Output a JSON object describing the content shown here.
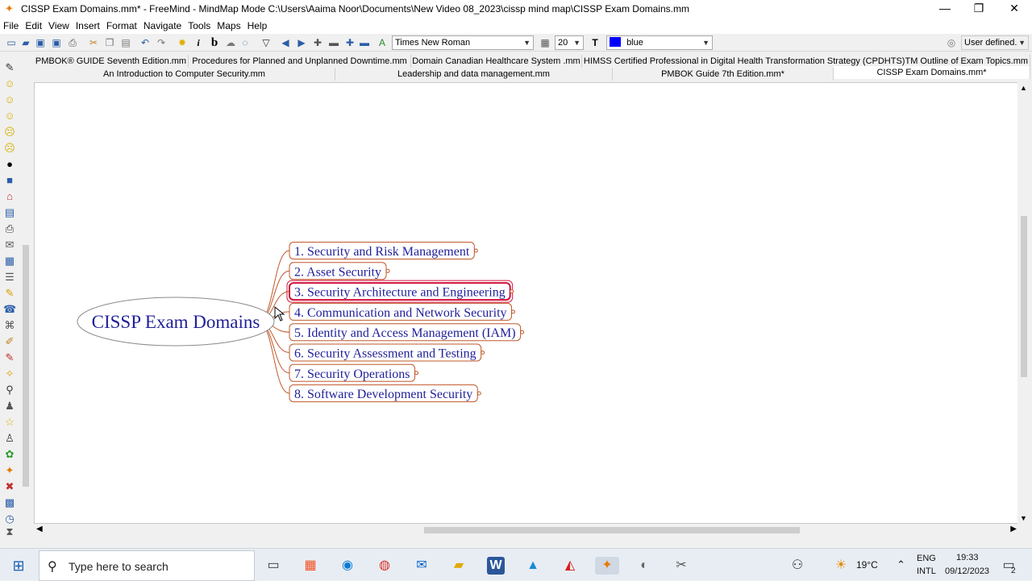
{
  "window": {
    "title": "CISSP Exam Domains.mm* - FreeMind - MindMap Mode C:\\Users\\Aaima Noor\\Documents\\New Video 08_2023\\cissp mind map\\CISSP Exam Domains.mm",
    "minimize": "—",
    "maximize": "❐",
    "close": "✕"
  },
  "menu": [
    "File",
    "Edit",
    "View",
    "Insert",
    "Format",
    "Navigate",
    "Tools",
    "Maps",
    "Help"
  ],
  "toolbar": {
    "font_name": "Times New Roman",
    "font_size": "20",
    "color_name": "blue",
    "color_value": "#0000ff",
    "mode": "User defined.",
    "bold_label": "b",
    "italic_label": "i"
  },
  "tabs": {
    "row1": [
      "PMBOK® GUIDE Seventh Edition.mm",
      "Procedures for Planned and Unplanned Downtime.mm",
      "Domain Canadian Healthcare System .mm",
      "HIMSS Certified Professional in Digital Health Transformation Strategy (CPDHTS)TM Outline of Exam Topics.mm"
    ],
    "row2": [
      "An Introduction to Computer Security.mm",
      "Leadership and data management.mm",
      "PMBOK Guide 7th Edition.mm*",
      "CISSP Exam Domains.mm*"
    ]
  },
  "mindmap": {
    "root": "CISSP Exam Domains",
    "selected_index": 2,
    "nodes": [
      "1. Security and Risk Management",
      "2. Asset Security",
      "3. Security Architecture and Engineering",
      "4. Communication and Network Security",
      "5. Identity and Access Management (IAM)",
      "6. Security Assessment and Testing",
      "7. Security Operations",
      "8. Software Development Security"
    ],
    "node_color": "#1f1f9a",
    "edge_color": "#c0582a",
    "selected_border_color": "#d0103a"
  },
  "taskbar": {
    "search_placeholder": "Type here to search",
    "weather": "19°C",
    "language_top": "ENG",
    "language_bottom": "INTL",
    "time": "19:33",
    "date": "09/12/2023",
    "notification_count": "2"
  }
}
